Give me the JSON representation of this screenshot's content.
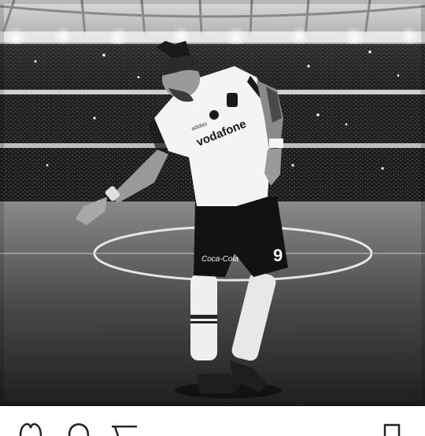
{
  "photo": {
    "jersey_sponsor": "vodafone",
    "kit_brand": "adidas",
    "shorts_sponsor": "Coca-Cola",
    "shorts_number": "9"
  },
  "actions": {
    "icons": [
      "heart-icon",
      "comment-icon",
      "share-icon",
      "bookmark-icon"
    ]
  },
  "colors": {
    "background": "#ffffff",
    "photo_dark": "#141414",
    "photo_light": "#e8e8e8"
  }
}
